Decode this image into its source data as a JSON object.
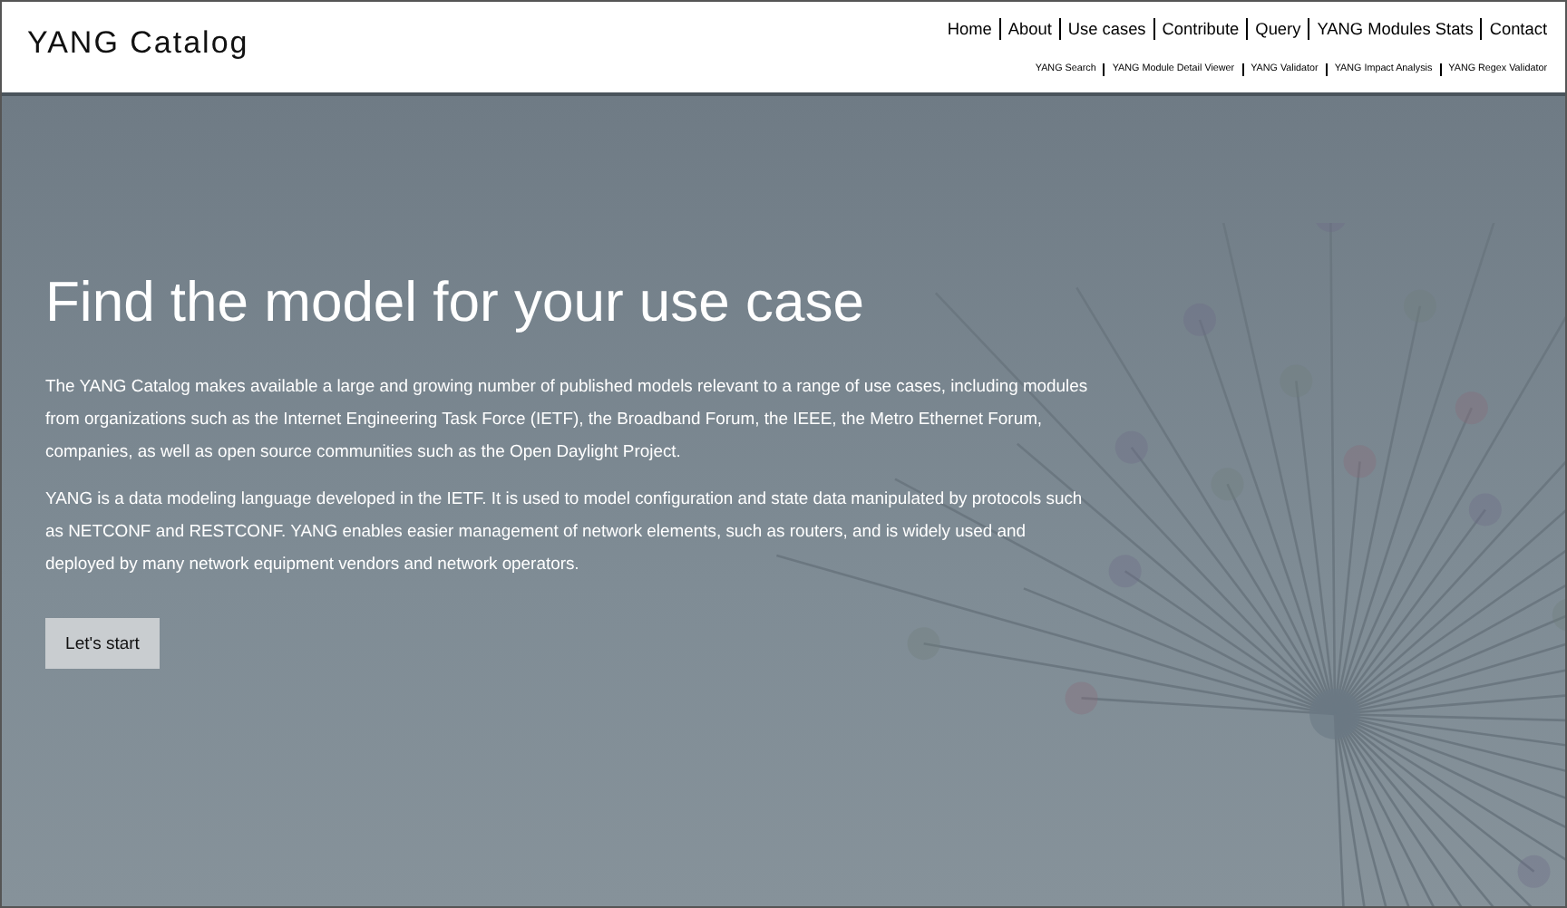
{
  "header": {
    "logo": "YANG Catalog",
    "main_nav": [
      "Home",
      "About",
      "Use cases",
      "Contribute",
      "Query",
      "YANG Modules Stats",
      "Contact"
    ],
    "sub_nav": [
      "YANG Search",
      "YANG Module Detail Viewer",
      "YANG Validator",
      "YANG Impact Analysis",
      "YANG Regex Validator"
    ]
  },
  "hero": {
    "title": "Find the model for your use case",
    "paragraphs": [
      "The YANG Catalog makes available a large and growing number of published models relevant to a range of use cases, including modules from organizations such as the Internet Engineering Task Force (IETF), the Broadband Forum, the IEEE, the Metro Ethernet Forum, companies, as well as open source communities such as the Open Daylight Project.",
      "YANG is a data modeling language developed in the IETF. It is used to model configuration and state data manipulated by protocols such as NETCONF and RESTCONF. YANG enables easier management of network elements, such as routers, and is widely used and deployed by many network equipment vendors and network operators."
    ],
    "button": "Let's start"
  }
}
